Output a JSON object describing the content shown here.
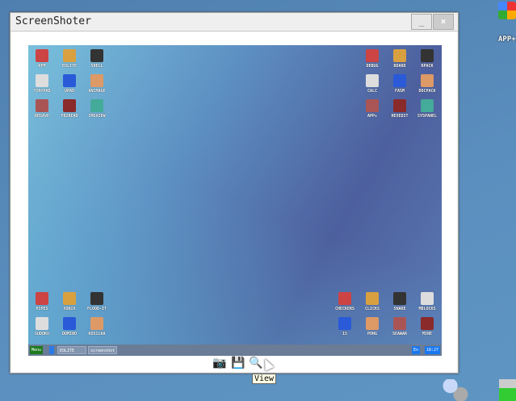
{
  "window": {
    "title": "ScreenShoter",
    "minimize": "_",
    "close": "×"
  },
  "screenshot": {
    "icons_top_left": [
      "KFM",
      "EOLITE",
      "SHELL",
      "TINYPAD",
      "UPAD",
      "ANIMAGE",
      "RDSAVE",
      "FB2READ",
      "IMGVIEW"
    ],
    "icons_top_right": [
      "DEBUG",
      "BOARD",
      "KPACK",
      "CALC",
      "FASM",
      "DOCPACK",
      "APP+",
      "HEXEDIT",
      "SYSPANEL"
    ],
    "icons_bottom_left": [
      "PIPES",
      "XONIX",
      "FLOOD-IT",
      "SUDOKU",
      "DOMINO",
      "KOSILKA"
    ],
    "icons_bottom_right": [
      "CHECKERS",
      "CLICKS",
      "SNAKE",
      "MBLOCKS",
      "15",
      "PONG",
      "SEAWAR",
      "MINE"
    ],
    "taskbar": {
      "menu": "Menu",
      "tasks": [
        "EOLITE",
        "screenshot"
      ],
      "lang": "En",
      "time": "18:27"
    }
  },
  "toolbar": {
    "tooltip": "View",
    "buttons": [
      "camera-icon",
      "save-icon",
      "view-icon"
    ]
  },
  "desktop": {
    "icon_label": "APP+"
  }
}
